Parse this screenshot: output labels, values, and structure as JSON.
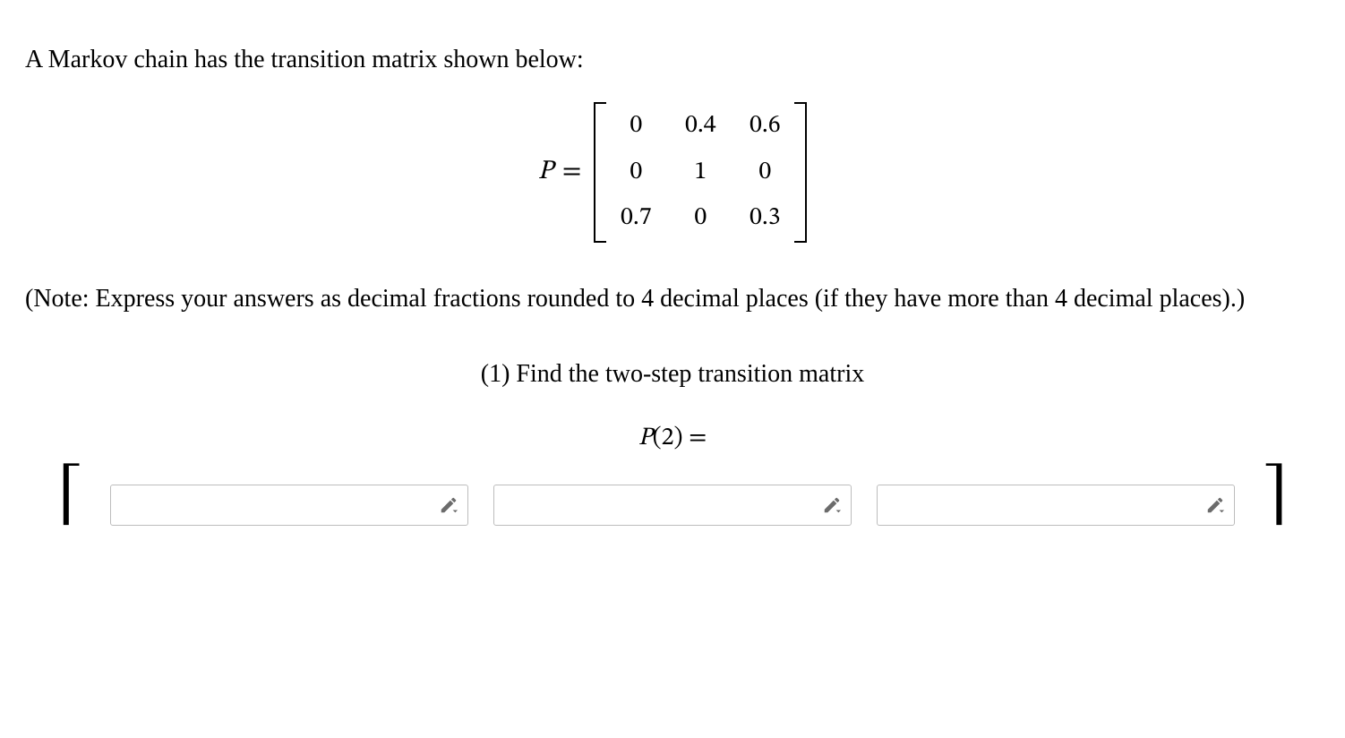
{
  "problem": {
    "intro": "A Markov chain has the transition matrix shown below:",
    "matrix_label": "P",
    "equals": "=",
    "matrix": {
      "r1": {
        "c1": "0",
        "c2": "0.4",
        "c3": "0.6"
      },
      "r2": {
        "c1": "0",
        "c2": "1",
        "c3": "0"
      },
      "r3": {
        "c1": "0.7",
        "c2": "0",
        "c3": "0.3"
      }
    },
    "note": "(Note: Express your answers as decimal fractions rounded to 4 decimal places (if they have more than 4 decimal places).)",
    "q1_label": "(1) Find the two-step transition matrix",
    "p2_lhs_P": "P",
    "p2_lhs_arg": "(2)",
    "p2_eq": " = "
  },
  "inputs": {
    "cell_1": "",
    "cell_2": "",
    "cell_3": ""
  },
  "icons": {
    "pencil_name": "pencil-dropdown-icon"
  }
}
